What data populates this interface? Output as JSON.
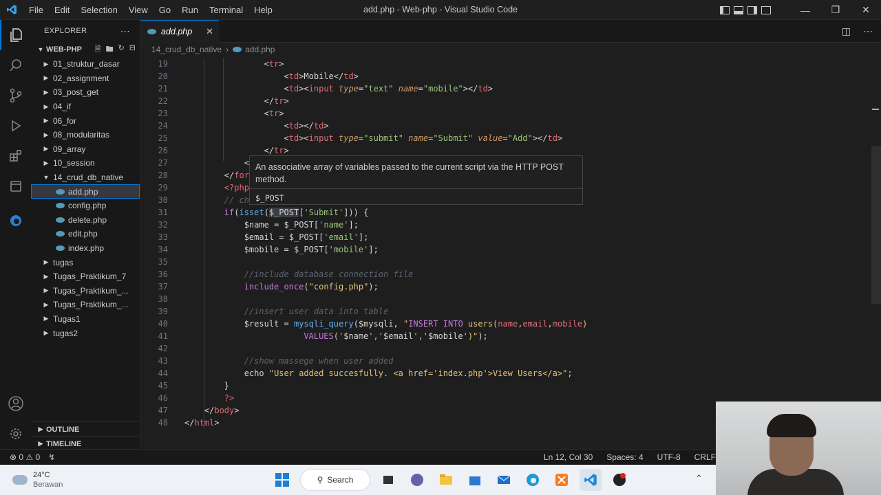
{
  "window": {
    "title": "add.php - Web-php - Visual Studio Code",
    "menu": [
      "File",
      "Edit",
      "Selection",
      "View",
      "Go",
      "Run",
      "Terminal",
      "Help"
    ]
  },
  "explorer": {
    "header": "EXPLORER",
    "workspace": "WEB-PHP",
    "items": [
      {
        "label": "01_struktur_dasar",
        "type": "folder",
        "open": false,
        "indent": 1
      },
      {
        "label": "02_assignment",
        "type": "folder",
        "open": false,
        "indent": 1
      },
      {
        "label": "03_post_get",
        "type": "folder",
        "open": false,
        "indent": 1
      },
      {
        "label": "04_if",
        "type": "folder",
        "open": false,
        "indent": 1
      },
      {
        "label": "06_for",
        "type": "folder",
        "open": false,
        "indent": 1
      },
      {
        "label": "08_modularitas",
        "type": "folder",
        "open": false,
        "indent": 1
      },
      {
        "label": "09_array",
        "type": "folder",
        "open": false,
        "indent": 1
      },
      {
        "label": "10_session",
        "type": "folder",
        "open": false,
        "indent": 1
      },
      {
        "label": "14_crud_db_native",
        "type": "folder",
        "open": true,
        "indent": 1
      },
      {
        "label": "add.php",
        "type": "file",
        "selected": true,
        "indent": 2
      },
      {
        "label": "config.php",
        "type": "file",
        "indent": 2
      },
      {
        "label": "delete.php",
        "type": "file",
        "indent": 2
      },
      {
        "label": "edit.php",
        "type": "file",
        "indent": 2
      },
      {
        "label": "index.php",
        "type": "file",
        "indent": 2
      },
      {
        "label": "tugas",
        "type": "folder",
        "open": false,
        "indent": 1
      },
      {
        "label": "Tugas_Praktikum_7",
        "type": "folder",
        "open": false,
        "indent": 1
      },
      {
        "label": "Tugas_Praktikum_...",
        "type": "folder",
        "open": false,
        "indent": 1
      },
      {
        "label": "Tugas_Praktikum_...",
        "type": "folder",
        "open": false,
        "indent": 1
      },
      {
        "label": "Tugas1",
        "type": "folder",
        "open": false,
        "indent": 1
      },
      {
        "label": "tugas2",
        "type": "folder",
        "open": false,
        "indent": 1
      }
    ],
    "outline": "OUTLINE",
    "timeline": "TIMELINE"
  },
  "editor": {
    "tab_label": "add.php",
    "breadcrumb": [
      "14_crud_db_native",
      "add.php"
    ],
    "hover": {
      "description": "An associative array of variables passed to the current script via the HTTP POST method.",
      "signature": "$_POST"
    }
  },
  "status": {
    "problems": "0",
    "warnings": "0",
    "position": "Ln 12, Col 30",
    "spaces": "Spaces: 4",
    "encoding": "UTF-8",
    "eol": "CRLF"
  },
  "taskbar": {
    "temperature": "24°C",
    "weather": "Berawan",
    "search": "Search"
  },
  "colors": {
    "accent": "#0078d4",
    "php_icon": "#519aba"
  }
}
